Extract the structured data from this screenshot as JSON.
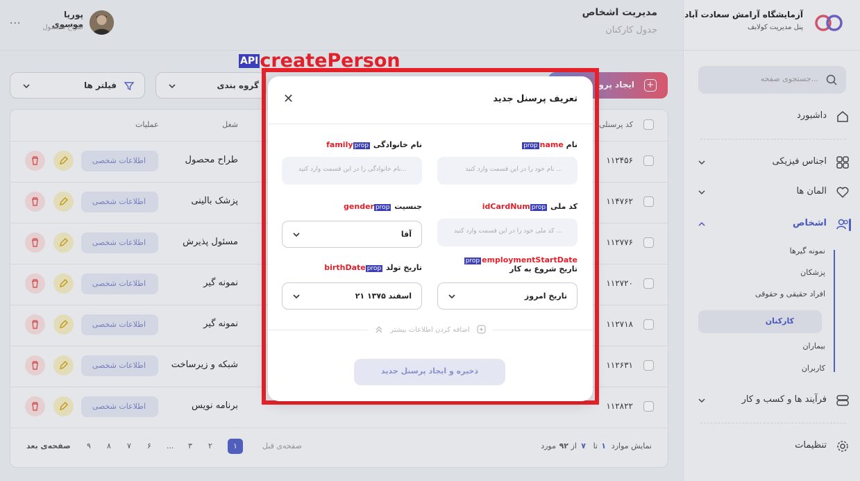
{
  "app": {
    "title": "آزمایشگاه آرامش سعادت آباد",
    "subtitle": "پنل مدیریت کولابف"
  },
  "search": {
    "placeholder": "جستجوی صفحه..."
  },
  "sidebar": {
    "items": [
      {
        "label": "داشبورد",
        "icon": "home-icon"
      },
      {
        "label": "اجناس فیزیکی",
        "icon": "grid-icon"
      },
      {
        "label": "المان ها",
        "icon": "heart-icon"
      },
      {
        "label": "اشخاص",
        "icon": "users-icon"
      },
      {
        "label": "فرآیند ها و کسب و کار",
        "icon": "stack-icon"
      },
      {
        "label": "تنظیمات",
        "icon": "gear-icon"
      }
    ],
    "people_subitems": [
      "نمونه گیرها",
      "پزشکان",
      "افراد حقیقی و حقوقی",
      "کارکنان",
      "بیماران",
      "کاربران"
    ]
  },
  "header": {
    "title": "مدیریت اشخاص",
    "subtitle": "جدول کارکنان",
    "user_name": "پوریا موسوی",
    "user_role": "طراح محصول",
    "more": "..."
  },
  "toolbar": {
    "create_label": "ایجاد پرو",
    "group_label": "گروه بندی",
    "filter_label": "فیلتر ها"
  },
  "table": {
    "headers": {
      "code": "کد پرسنلی",
      "job": "شغل",
      "ops": "عملیات"
    },
    "personal_info_label": "اطلاعات شخصی",
    "rows": [
      {
        "code": "۱۱۲۴۵۶",
        "job": "طراح محصول"
      },
      {
        "code": "۱۱۴۷۶۲",
        "job": "پزشک بالینی"
      },
      {
        "code": "۱۱۲۷۷۶",
        "job": "مسئول پذیرش"
      },
      {
        "code": "۱۱۲۷۲۰",
        "job": "نمونه گیر"
      },
      {
        "code": "۱۱۲۷۱۸",
        "job": "نمونه گیر"
      },
      {
        "code": "۱۱۲۶۳۱",
        "job": "شبکه و زیرساخت"
      },
      {
        "code": "۱۱۲۸۲۲",
        "job": "برنامه نویس"
      }
    ]
  },
  "pagination": {
    "summary": [
      "نمایش موارد",
      "۱",
      "تا",
      "۷",
      "از",
      "۹۲",
      "مورد"
    ],
    "prev": "صفحه‌ی قبل",
    "next": "صفحه‌ی بعد",
    "pages": [
      "۱",
      "۲",
      "۳",
      "...",
      "۶",
      "۷",
      "۸",
      "۹"
    ],
    "current": "۱"
  },
  "annotation": {
    "api_badge": "API",
    "api_name": "createPerson",
    "prop_badge": "prop"
  },
  "modal": {
    "title": "تعریف پرسنل جدید",
    "fields": {
      "name": {
        "label": "نام",
        "prop": "name",
        "placeholder": "نام خود را در این قسمت وارد کنید ..."
      },
      "family": {
        "label": "نام خانوادگی",
        "prop": "family",
        "placeholder": "نام خانوادگی را در این قسمت وارد کنید..."
      },
      "idcard": {
        "label": "کد ملی",
        "prop": "idCardNum",
        "placeholder": "کد ملی خود را در این قسمت وارد کنید ..."
      },
      "gender": {
        "label": "جنسیت",
        "prop": "gender",
        "value": "آقا"
      },
      "start": {
        "label": "تاریخ شروع به کار",
        "prop": "employmentStartDate",
        "value": "تاریخ امروز"
      },
      "birth": {
        "label": "تاریخ تولد",
        "prop": "birthDate",
        "value": "۲۱ اسفند ۱۳۷۵"
      }
    },
    "more_info": "اضافه کردن اطلاعات بیشتر",
    "save_label": "ذخیره و ایجاد پرسنل جدید"
  }
}
